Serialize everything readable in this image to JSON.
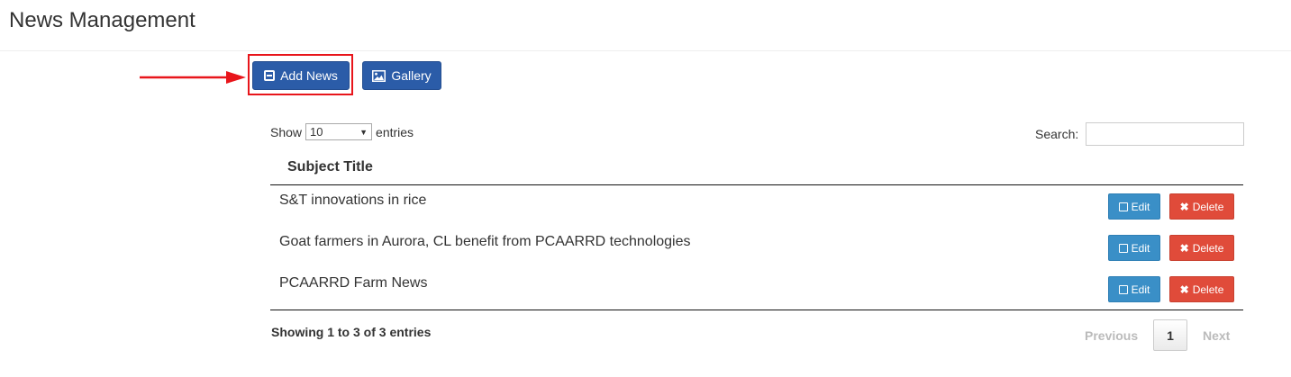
{
  "header": {
    "title": "News Management"
  },
  "toolbar": {
    "add_label": "Add News",
    "gallery_label": "Gallery"
  },
  "length": {
    "show": "Show",
    "value": "10",
    "entries": "entries"
  },
  "search": {
    "label": "Search:",
    "value": ""
  },
  "table": {
    "column": "Subject Title",
    "rows": [
      {
        "title": "S&T innovations in rice",
        "edit": "Edit",
        "delete": "Delete"
      },
      {
        "title": "Goat farmers in Aurora, CL benefit from PCAARRD technologies",
        "edit": "Edit",
        "delete": "Delete"
      },
      {
        "title": "PCAARRD Farm News",
        "edit": "Edit",
        "delete": "Delete"
      }
    ]
  },
  "info": "Showing 1 to 3 of 3 entries",
  "pagination": {
    "previous": "Previous",
    "current": "1",
    "next": "Next"
  },
  "colors": {
    "primary": "#2b5ca8",
    "edit": "#3a8fc7",
    "delete": "#e04b3a",
    "highlight": "#e8151b"
  },
  "icons": {
    "add": "book-icon",
    "gallery": "picture-icon",
    "edit": "edit-icon",
    "delete": "x-icon"
  }
}
